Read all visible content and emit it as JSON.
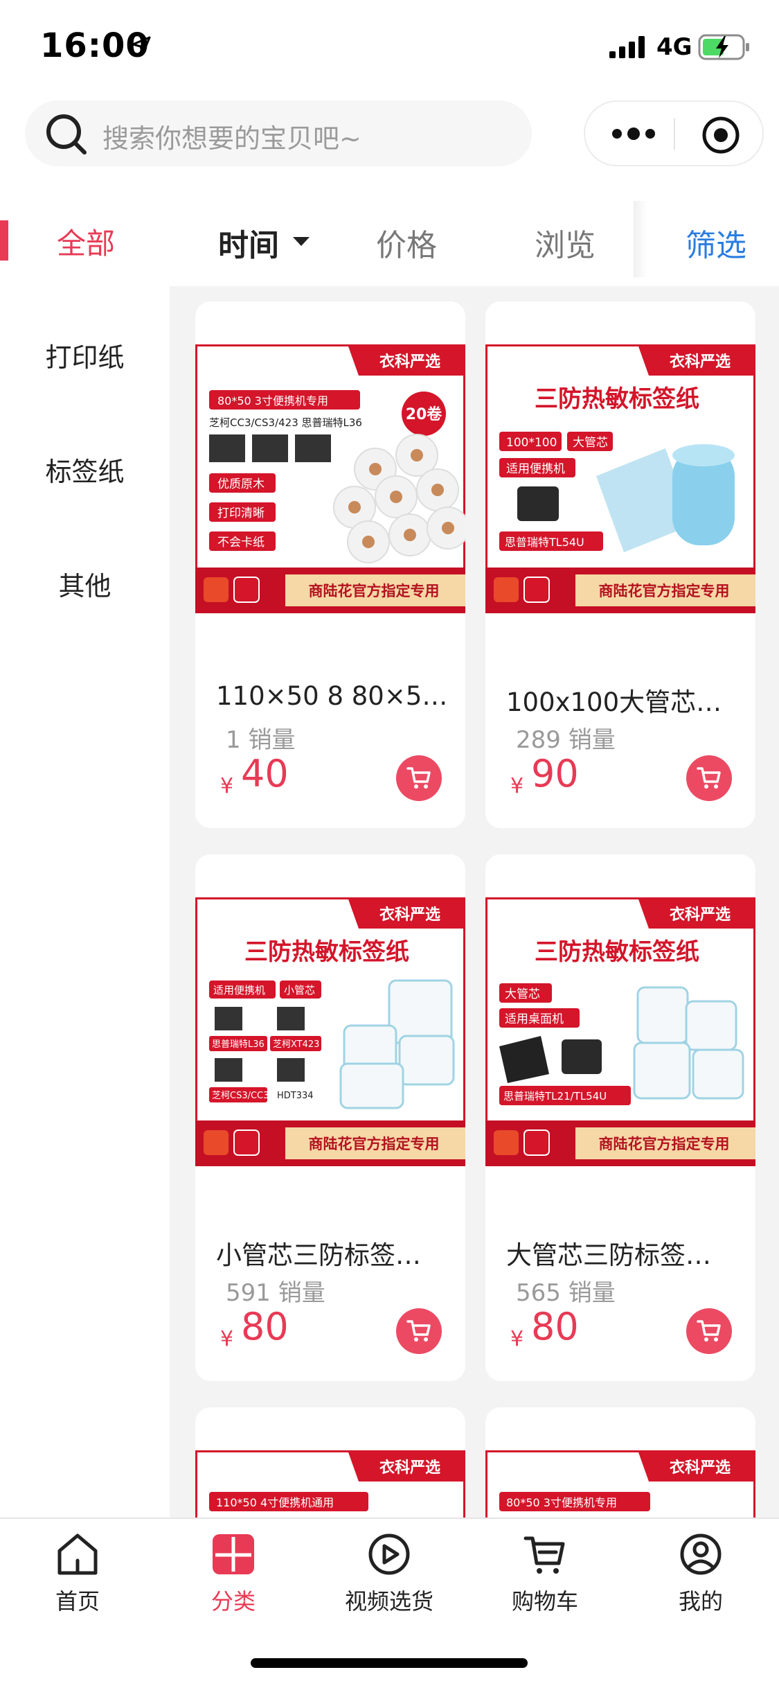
{
  "status_bar": {
    "time": "16:00",
    "network": "4G"
  },
  "search": {
    "placeholder": "搜索你想要的宝贝吧~"
  },
  "filter": {
    "all": "全部",
    "sort_time": "时间",
    "sort_price": "价格",
    "sort_browse": "浏览",
    "filter": "筛选"
  },
  "sidebar": {
    "items": [
      "打印纸",
      "标签纸",
      "其他"
    ]
  },
  "products": [
    {
      "title": "110×50 8 80×5…",
      "sales": "1 销量",
      "currency": "¥",
      "price": "40",
      "image": {
        "badge": "衣科严选",
        "headline": "",
        "tags": [
          "80*50  3寸便携机专用",
          "芝柯CC3/CS3/423  思普瑞特L36",
          "优质原木",
          "打印清晰",
          "不会卡纸"
        ],
        "count": "20卷",
        "footer": "商陆花官方指定专用"
      }
    },
    {
      "title": "100x100大管芯…",
      "sales": "289 销量",
      "currency": "¥",
      "price": "90",
      "image": {
        "badge": "衣科严选",
        "headline": "三防热敏标签纸",
        "tags": [
          "100*100",
          "大管芯",
          "适用便携机",
          "思普瑞特TL54U"
        ],
        "footer": "商陆花官方指定专用"
      }
    },
    {
      "title": "小管芯三防标签…",
      "sales": "591 销量",
      "currency": "¥",
      "price": "80",
      "image": {
        "badge": "衣科严选",
        "headline": "三防热敏标签纸",
        "tags": [
          "适用便携机",
          "小管芯",
          "思普瑞特L36",
          "芝柯XT423",
          "芝柯CS3/CC3",
          "HDT334"
        ],
        "footer": "商陆花官方指定专用"
      }
    },
    {
      "title": "大管芯三防标签…",
      "sales": "565 销量",
      "currency": "¥",
      "price": "80",
      "image": {
        "badge": "衣科严选",
        "headline": "三防热敏标签纸",
        "tags": [
          "大管芯",
          "适用桌面机",
          "思普瑞特TL21/TL54U"
        ],
        "footer": "商陆花官方指定专用"
      }
    },
    {
      "image": {
        "badge": "衣科严选",
        "tags": [
          "110*50  4寸便携机通用"
        ]
      }
    },
    {
      "image": {
        "badge": "衣科严选",
        "tags": [
          "80*50  3寸便携机专用"
        ]
      }
    }
  ],
  "tabbar": {
    "items": [
      {
        "label": "首页",
        "icon": "home-icon"
      },
      {
        "label": "分类",
        "icon": "category-icon",
        "active": true
      },
      {
        "label": "视频选货",
        "icon": "video-play-icon"
      },
      {
        "label": "购物车",
        "icon": "cart-icon"
      },
      {
        "label": "我的",
        "icon": "user-icon"
      }
    ]
  },
  "colors": {
    "accent": "#e83a55",
    "link": "#2a7de1",
    "banner_red": "#d4152a"
  }
}
